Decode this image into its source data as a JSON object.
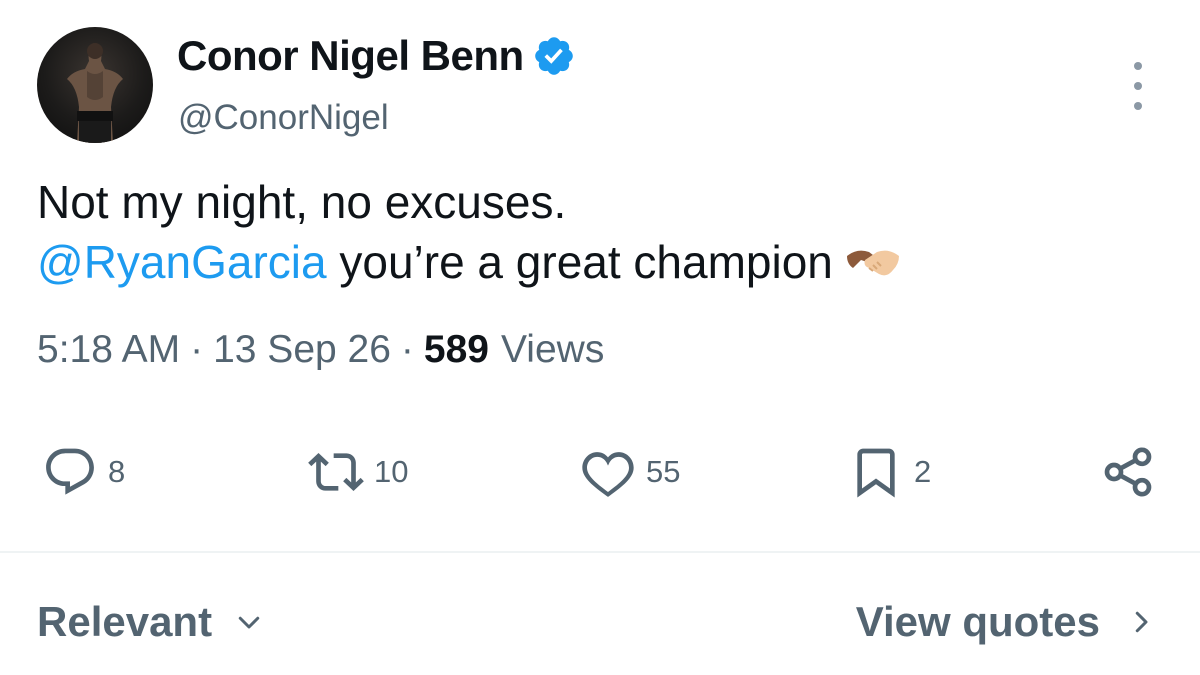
{
  "author": {
    "display_name": "Conor Nigel Benn",
    "handle": "@ConorNigel",
    "verified": true
  },
  "tweet": {
    "line1": "Not my night, no excuses.",
    "mention": "@RyanGarcia",
    "line2_rest": " you’re a great champion",
    "emoji": "handshake"
  },
  "meta": {
    "time": "5:18 AM",
    "separator": "·",
    "date": "13 Sep 26",
    "views_count": "589",
    "views_label": "Views"
  },
  "actions": {
    "replies": "8",
    "retweets": "10",
    "likes": "55",
    "bookmarks": "2"
  },
  "footer": {
    "sort_label": "Relevant",
    "quotes_label": "View quotes"
  },
  "colors": {
    "accent": "#1d9bf0",
    "text": "#0f1419",
    "secondary": "#536471"
  }
}
